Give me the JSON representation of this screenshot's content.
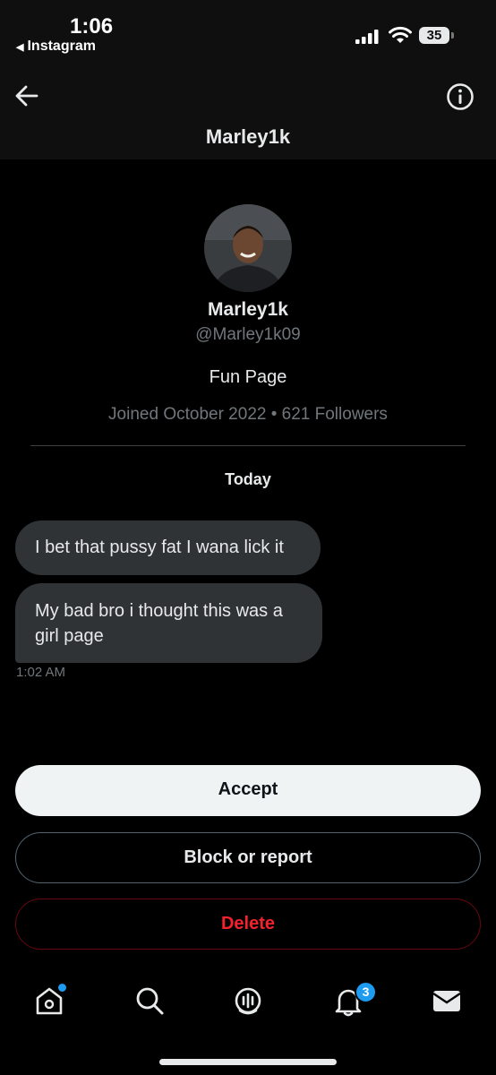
{
  "status_bar": {
    "time": "1:06",
    "back_app": "Instagram",
    "battery": "35"
  },
  "header": {
    "title": "Marley1k"
  },
  "profile": {
    "name": "Marley1k",
    "handle": "@Marley1k09",
    "bio": "Fun Page",
    "meta": "Joined October 2022 • 621 Followers"
  },
  "conversation": {
    "date_label": "Today",
    "messages": [
      {
        "text": "I bet that pussy fat I wana lick it"
      },
      {
        "text": "My bad bro i thought this was a girl page"
      }
    ],
    "last_time": "1:02 AM"
  },
  "actions": {
    "accept": "Accept",
    "block": "Block or report",
    "delete": "Delete"
  },
  "nav": {
    "items": [
      "home-icon",
      "search-icon",
      "spaces-icon",
      "notifications-icon",
      "messages-icon"
    ],
    "notifications_badge": "3"
  },
  "colors": {
    "accent": "#1d9bf0",
    "danger": "#f4212e",
    "bubble": "#2f3336"
  }
}
